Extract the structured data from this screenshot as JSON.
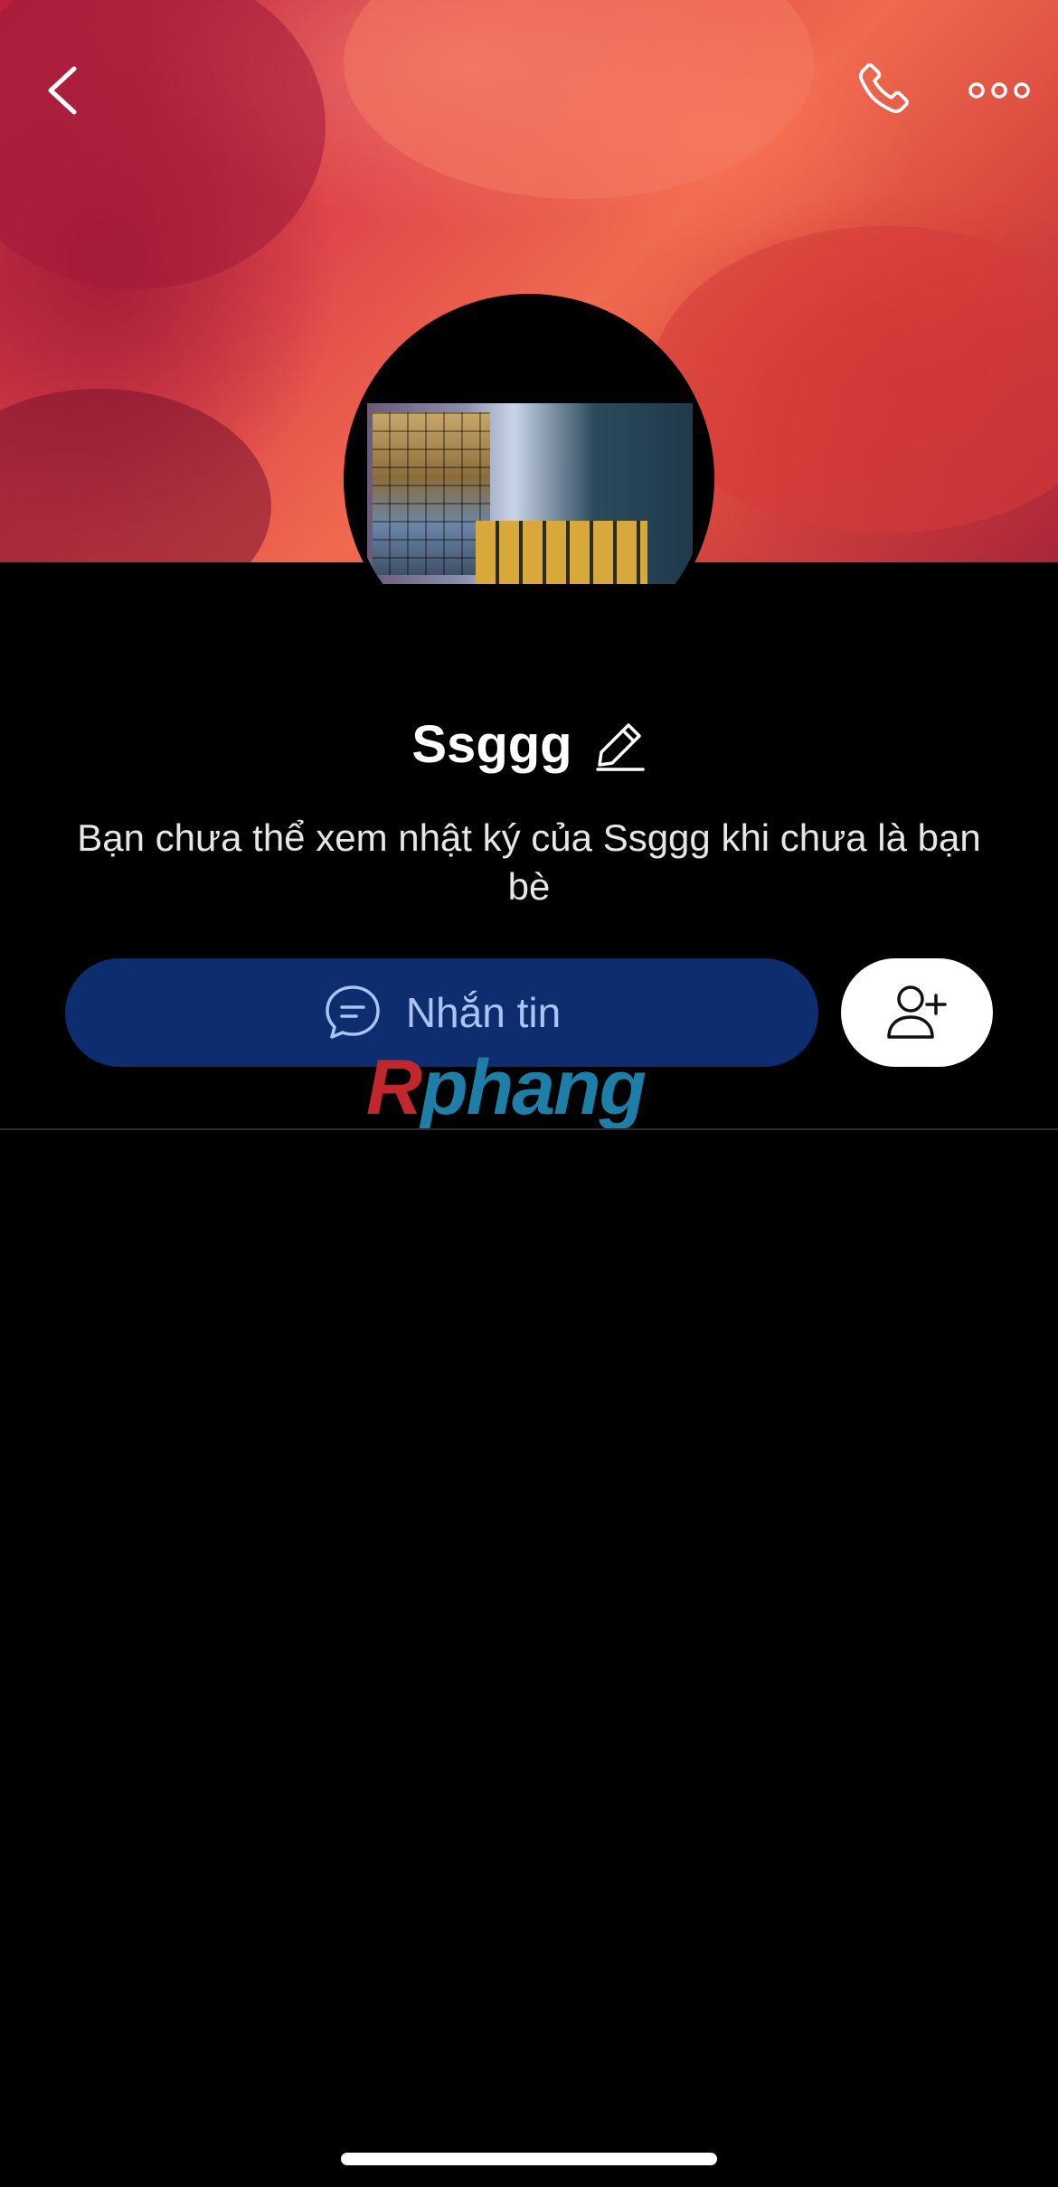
{
  "header": {
    "back_icon": "chevron-left-icon",
    "call_icon": "phone-icon",
    "more_icon": "more-horizontal-icon"
  },
  "profile": {
    "name": "Ssggg",
    "notice": "Bạn chưa thể xem nhật ký của Ssggg khi chưa là bạn bè"
  },
  "actions": {
    "message_label": "Nhắn tin",
    "message_icon": "chat-bubble-icon",
    "add_friend_icon": "add-user-icon"
  },
  "watermark": {
    "first": "R",
    "rest": "phang"
  },
  "colors": {
    "background": "#000000",
    "message_button": "#0d2d6e",
    "message_label": "#a9c4f5",
    "add_friend_button": "#ffffff"
  }
}
